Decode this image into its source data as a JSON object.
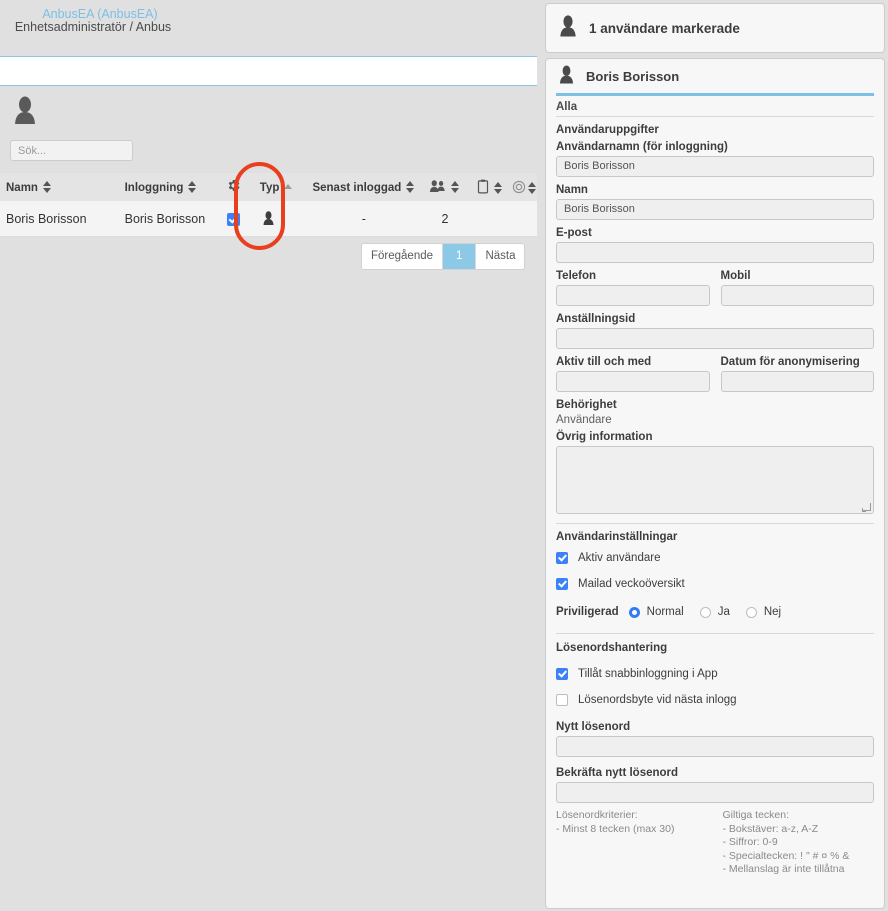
{
  "breadcrumb": {
    "org": "AnbusEA (AnbusEA)",
    "role": "Enhetsadministratör / Anbus"
  },
  "search": {
    "placeholder": "Sök...",
    "value": ""
  },
  "table": {
    "columns": [
      {
        "label": "Namn",
        "icon": "",
        "sort": "both"
      },
      {
        "label": "Inloggning",
        "icon": "",
        "sort": "both"
      },
      {
        "label": "",
        "icon": "gear-icon",
        "sort": "none"
      },
      {
        "label": "Typ",
        "icon": "",
        "sort": "asc"
      },
      {
        "label": "Senast inloggad",
        "icon": "",
        "sort": "both"
      },
      {
        "label": "",
        "icon": "users-icon",
        "sort": "both"
      },
      {
        "label": "",
        "icon": "clipboard-icon",
        "sort": "both"
      },
      {
        "label": "",
        "icon": "target-icon",
        "sort": "both"
      }
    ],
    "rows": [
      {
        "namn": "Boris Borisson",
        "inloggning": "Boris Borisson",
        "selected": true,
        "typ_icon": "person-icon",
        "senast_inloggad": "-",
        "antal": "2",
        "clipboard": "",
        "target": ""
      }
    ]
  },
  "pagination": {
    "previous": "Föregående",
    "current": "1",
    "next": "Nästa"
  },
  "panel": {
    "selection_header": "1 användare markerade",
    "selection_icon": "person-icon",
    "user_header": "Boris Borisson",
    "user_icon": "person-icon",
    "tab_all": "Alla",
    "section_userdata": "Användaruppgifter",
    "fields": {
      "username_label": "Användarnamn (för inloggning)",
      "username_value": "Boris Borisson",
      "name_label": "Namn",
      "name_value": "Boris Borisson",
      "email_label": "E-post",
      "email_value": "",
      "phone_label": "Telefon",
      "phone_value": "",
      "mobile_label": "Mobil",
      "mobile_value": "",
      "employment_id_label": "Anställningsid",
      "employment_id_value": "",
      "active_until_label": "Aktiv till och med",
      "active_until_value": "",
      "anonymization_date_label": "Datum för anonymisering",
      "anonymization_date_value": "",
      "permission_label": "Behörighet",
      "permission_value": "Användare",
      "other_info_label": "Övrig information",
      "other_info_value": ""
    },
    "settings": {
      "title": "Användarinställningar",
      "checkboxes": [
        {
          "label": "Aktiv användare",
          "checked": true
        },
        {
          "label": "Mailad veckoöversikt",
          "checked": true
        }
      ],
      "privileged_label": "Priviligerad",
      "privileged_options": [
        {
          "label": "Normal",
          "selected": true
        },
        {
          "label": "Ja",
          "selected": false
        },
        {
          "label": "Nej",
          "selected": false
        }
      ]
    },
    "password": {
      "title": "Lösenordshantering",
      "checkboxes": [
        {
          "label": "Tillåt snabbinloggning i App",
          "checked": true
        },
        {
          "label": "Lösenordsbyte vid nästa inlogg",
          "checked": false
        }
      ],
      "new_password_label": "Nytt lösenord",
      "new_password_value": "",
      "confirm_password_label": "Bekräfta nytt lösenord",
      "confirm_password_value": "",
      "criteria_title": "Lösenordkriterier:",
      "criteria_lines": [
        "- Minst 8 tecken (max 30)"
      ],
      "valid_title": "Giltiga tecken:",
      "valid_lines": [
        "- Bokstäver: a-z, A-Z",
        "- Siffror: 0-9",
        "- Specialtecken: ! \" # ¤ % &",
        "- Mellanslag är inte tillåtna"
      ]
    }
  },
  "colors": {
    "accent_blue": "#7cc0e5",
    "checkbox_blue": "#3b82f6",
    "annotation_red": "#e8401f",
    "page_bg": "#e0e0e0"
  }
}
